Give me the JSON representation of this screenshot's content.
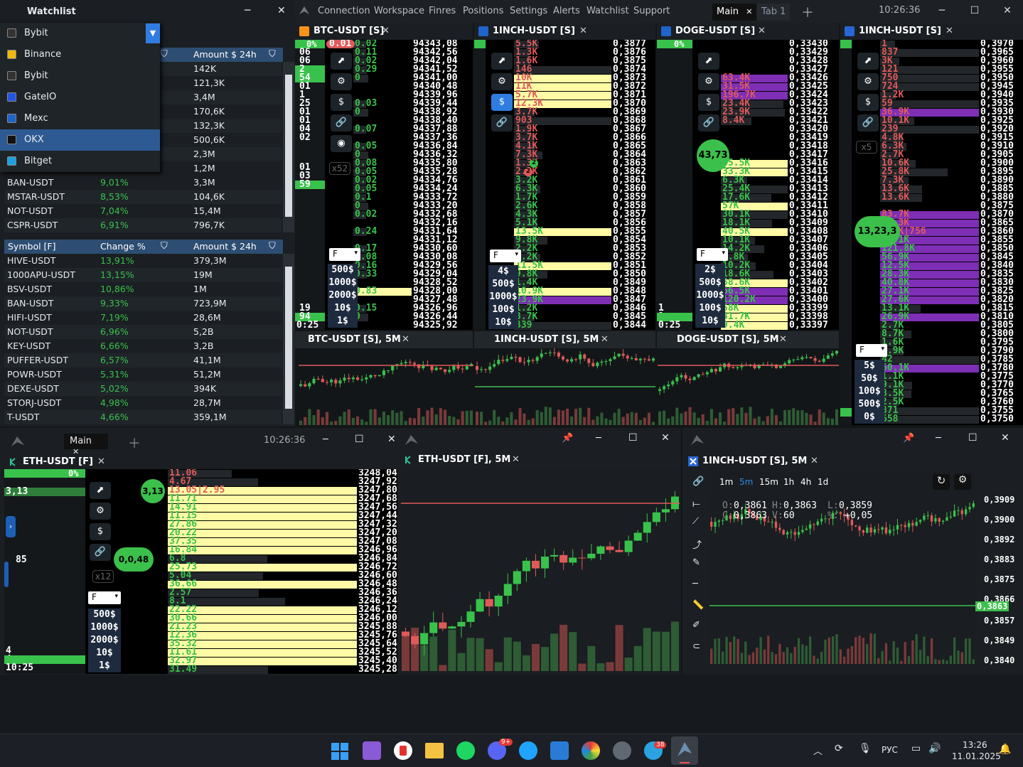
{
  "topbar": {
    "menu": [
      "Connection",
      "Workspace",
      "Finres",
      "Positions",
      "Settings",
      "Alerts",
      "Watchlist",
      "Support"
    ],
    "tab_main": "Main",
    "tab_1": "Tab 1",
    "time": "10:26:36"
  },
  "watchlist": {
    "title": "Watchlist",
    "dropdown_value": "Bybit",
    "exchanges": [
      "Bybit",
      "Binance",
      "Bybit",
      "GateIO",
      "Mexc",
      "OKX",
      "Bitget"
    ],
    "table1": {
      "header_change": "Change %",
      "header_amount": "Amount $ 24h",
      "amounts_hidden": [
        "142K",
        "121,3K",
        "3,4M",
        "170,6K",
        "132,3K",
        "500,6K",
        "2,3M",
        "1,2M"
      ],
      "rows": [
        {
          "s": "BAN-USDT",
          "c": "9,01%",
          "a": "3,3M"
        },
        {
          "s": "MSTAR-USDT",
          "c": "8,53%",
          "a": "104,6K"
        },
        {
          "s": "NOT-USDT",
          "c": "7,04%",
          "a": "15,4M"
        },
        {
          "s": "CSPR-USDT",
          "c": "6,91%",
          "a": "796,7K"
        }
      ]
    },
    "table2": {
      "header_symbol": "Symbol [F]",
      "header_change": "Change %",
      "header_amount": "Amount $ 24h",
      "rows": [
        {
          "s": "HIVE-USDT",
          "c": "13,91%",
          "a": "379,3M"
        },
        {
          "s": "1000APU-USDT",
          "c": "13,15%",
          "a": "19M"
        },
        {
          "s": "BSV-USDT",
          "c": "10,86%",
          "a": "1M"
        },
        {
          "s": "BAN-USDT",
          "c": "9,33%",
          "a": "723,9M"
        },
        {
          "s": "HIFI-USDT",
          "c": "7,19%",
          "a": "28,6M"
        },
        {
          "s": "NOT-USDT",
          "c": "6,96%",
          "a": "5,2B"
        },
        {
          "s": "KEY-USDT",
          "c": "6,66%",
          "a": "3,2B"
        },
        {
          "s": "PUFFER-USDT",
          "c": "6,57%",
          "a": "41,1M"
        },
        {
          "s": "POWR-USDT",
          "c": "5,31%",
          "a": "51,2M"
        },
        {
          "s": "DEXE-USDT",
          "c": "5,02%",
          "a": "394K"
        },
        {
          "s": "STORJ-USDT",
          "c": "4,98%",
          "a": "28,7M"
        },
        {
          "s": "T-USDT",
          "c": "4,66%",
          "a": "359,1M"
        }
      ]
    }
  },
  "panels": {
    "btc": {
      "title": "BTC-USDT [S]",
      "pct": "0%",
      "mult": "x52",
      "select": "F",
      "amounts": [
        "500$",
        "1000$",
        "2000$",
        "10$",
        "1$"
      ],
      "bottom_time": "0:25",
      "prices": [
        "94343,08",
        "94342,56",
        "94342,04",
        "94341,52",
        "94341,00",
        "94340,48",
        "94339,96",
        "94339,44",
        "94338,92",
        "94338,40",
        "94337,88",
        "94337,36",
        "94336,84",
        "94336,32",
        "94335,80",
        "94335,28",
        "94334,76",
        "94334,24",
        "94333,72",
        "94333,20",
        "94332,68",
        "94332,16",
        "94331,64",
        "94331,12",
        "94330,60",
        "94330,08",
        "94329,56",
        "94329,04",
        "94328,52",
        "94328,00",
        "94327,48",
        "94326,96",
        "94326,44",
        "94325,92"
      ],
      "vols": [
        "0.02",
        "0.11",
        "0.02",
        "0.29",
        "0",
        "",
        "",
        "0.03",
        "0",
        "",
        "0.07",
        "",
        "0.05",
        "0",
        "0.08",
        "0.05",
        "0.02",
        "0.05",
        "0.1",
        "0",
        "0.02",
        "",
        "0.24",
        "",
        "0.17",
        "0.08",
        "0.16",
        "0.33",
        "",
        "0.83",
        "",
        "0.15",
        "0",
        ""
      ],
      "left_vals": [
        "06",
        "06",
        "2",
        "54",
        "01",
        "1",
        "25",
        "01",
        "01",
        "04",
        "02"
      ],
      "left_vals2": [
        "01",
        "03",
        "59"
      ],
      "left_vals3": [
        "19",
        "94"
      ],
      "marker": "0.01"
    },
    "inch1": {
      "title": "1INCH-USDT [S]",
      "pct": "%",
      "select": "F",
      "amounts": [
        "4$",
        "500$",
        "1000$",
        "100$",
        "10$"
      ],
      "prices": [
        "0,3877",
        "0,3876",
        "0,3875",
        "0,3874",
        "0,3873",
        "0,3872",
        "0,3871",
        "0,3870",
        "0,3869",
        "0,3868",
        "0,3867",
        "0,3866",
        "0,3865",
        "0,3864",
        "0,3863",
        "0,3862",
        "0,3861",
        "0,3860",
        "0,3859",
        "0,3858",
        "0,3857",
        "0,3856",
        "0,3855",
        "0,3854",
        "0,3853",
        "0,3852",
        "0,3851",
        "0,3850",
        "0,3849",
        "0,3848",
        "0,3847",
        "0,3846",
        "0,3845",
        "0,3844"
      ],
      "vols": [
        "5.5K",
        "1.3K",
        "1.6K",
        "146",
        "10K",
        "11K",
        "5.7K",
        "12.3K",
        "3.7K",
        "903",
        "1.9K",
        "3.7K",
        "4.1K",
        "7.3K",
        "1.3K",
        "2.2K",
        "3.2K",
        "6.3K",
        "1.7K",
        "2.6K",
        "4.3K",
        "5.1K",
        "13.5K",
        "9.8K",
        "2.2K",
        "6.2K",
        "11.5K",
        "9.8K",
        "1.4K",
        "10.9K",
        "23.9K",
        "1.2K",
        "3.7K",
        "339"
      ],
      "badge1": "2",
      "badge2": "2"
    },
    "doge": {
      "title": "DOGE-USDT [S]",
      "pct": "0%",
      "select": "F",
      "amounts": [
        "2$",
        "500$",
        "1000$",
        "100$",
        "10$"
      ],
      "bubble": "43,73",
      "bottom_time": "0:25",
      "prices": [
        "0,33430",
        "0,33429",
        "0,33428",
        "0,33427",
        "0,33426",
        "0,33425",
        "0,33424",
        "0,33423",
        "0,33422",
        "0,33421",
        "0,33420",
        "0,33419",
        "0,33418",
        "0,33417",
        "0,33416",
        "0,33415",
        "0,33414",
        "0,33413",
        "0,33412",
        "0,33411",
        "0,33410",
        "0,33409",
        "0,33408",
        "0,33407",
        "0,33406",
        "0,33405",
        "0,33404",
        "0,33403",
        "0,33402",
        "0,33401",
        "0,33400",
        "0,33399",
        "0,33398",
        "0,33397"
      ],
      "vols": [
        "",
        "",
        "",
        "",
        "63.4K",
        "31.5K",
        "196.7K",
        "23.4K",
        "23.9K",
        "8.4K",
        "",
        "",
        "",
        "",
        "45.5K",
        "33.3K",
        "6.3K",
        "25.4K",
        "17.6K",
        "57K",
        "30.1K",
        "18.1K",
        "40.5K",
        "10.1K",
        "14.2K",
        "6.8K",
        "10.2K",
        "18.6K",
        "58.6K",
        "66.5K",
        "120.2K",
        "58K",
        "41.7K",
        "9.4K"
      ],
      "left_vals": [
        "1",
        "1"
      ]
    },
    "inch2": {
      "title": "1INCH-USDT [S]",
      "pct": "%",
      "mult": "x5",
      "select": "F",
      "amounts": [
        "5$",
        "50$",
        "100$",
        "500$",
        "0$"
      ],
      "bubble": "13,23,3",
      "prices": [
        "0,3970",
        "0,3965",
        "0,3960",
        "0,3955",
        "0,3950",
        "0,3945",
        "0,3940",
        "0,3935",
        "0,3930",
        "0,3925",
        "0,3920",
        "0,3915",
        "0,3910",
        "0,3905",
        "0,3900",
        "0,3895",
        "0,3890",
        "0,3885",
        "0,3880",
        "0,3875",
        "0,3870",
        "0,3865",
        "0,3860",
        "0,3855",
        "0,3850",
        "0,3845",
        "0,3840",
        "0,3835",
        "0,3830",
        "0,3825",
        "0,3820",
        "0,3815",
        "0,3810",
        "0,3805",
        "0,3800",
        "0,3795",
        "0,3790",
        "0,3785",
        "0,3780",
        "0,3775",
        "0,3770",
        "0,3765",
        "0,3760",
        "0,3755",
        "0,3750"
      ],
      "vols": [
        "1",
        "837",
        "3K",
        "121",
        "750",
        "724",
        "1.2K",
        "59",
        "36.9K",
        "10.1K",
        "239",
        "4.8K",
        "6.3K",
        "2.7K",
        "10.6K",
        "25.8K",
        "7.3K",
        "13.6K",
        "13.6K",
        "",
        "83.7K",
        "52.3K",
        "3.9K|756",
        "26.1K",
        "121.8K",
        "56.9K",
        "12.5K",
        "28.3K",
        "40.8K",
        "27.1K",
        "27.6K",
        "13.1K",
        "26.9K",
        "2.7K",
        "8.7K",
        "1.6K",
        "4.9K",
        "42",
        "60.1K",
        "1.1K",
        "9.1K",
        "8.5K",
        "2.5K",
        "871",
        "658"
      ]
    }
  },
  "mini_charts": {
    "btc": "BTC-USDT [S], 5M",
    "inch": "1INCH-USDT [S], 5M",
    "doge": "DOGE-USDT [S], 5M"
  },
  "eth_window": {
    "tab": "Main",
    "time": "10:26:36",
    "title": "ETH-USDT [F]",
    "pct": "0%",
    "left_val": "3,13",
    "left_val2": "85",
    "left_bottom": [
      "4",
      "4"
    ],
    "bottom_time": "10:25",
    "mult": "x12",
    "select": "F",
    "amounts": [
      "500$",
      "1000$",
      "2000$",
      "10$",
      "1$"
    ],
    "bubble1": "3,13",
    "bubble2": "0,0,48",
    "prices": [
      "3248,04",
      "3247,92",
      "3247,80",
      "3247,68",
      "3247,56",
      "3247,44",
      "3247,32",
      "3247,20",
      "3247,08",
      "3246,96",
      "3246,84",
      "3246,72",
      "3246,60",
      "3246,48",
      "3246,36",
      "3246,24",
      "3246,12",
      "3246,00",
      "3245,88",
      "3245,76",
      "3245,64",
      "3245,52",
      "3245,40",
      "3245,28"
    ],
    "vols": [
      "11.06",
      "4.67",
      "13.05|2.95",
      "11.71",
      "14.91",
      "11.15",
      "27.86",
      "20.22",
      "37.35",
      "16.84",
      "6.8",
      "25.73",
      "5.04",
      "36.66",
      "2.57",
      "8.1",
      "22.22",
      "30.66",
      "21.23",
      "12.36",
      "35.32",
      "11.61",
      "32.97",
      "31.49"
    ]
  },
  "eth_chart": {
    "title": "ETH-USDT [F], 5M"
  },
  "inch_chart": {
    "title": "1INCH-USDT [S], 5M",
    "timeframes": [
      "1m",
      "5m",
      "15m",
      "1h",
      "4h",
      "1d"
    ],
    "active_tf": "5m",
    "ohlc": {
      "o_label": "O:",
      "o": "0,3861",
      "h_label": "H:",
      "h": "0,3863",
      "l_label": "L:",
      "l": "0,3859",
      "c_label": "C:",
      "c": "0,3863",
      "v_label": "V:",
      "v": "60",
      "pct_label": "%:",
      "pct": "+0,05"
    },
    "y_ticks": [
      "0,3909",
      "0,3900",
      "0,3892",
      "0,3883",
      "0,3875",
      "0,3866",
      "0,3863",
      "0,3857",
      "0,3849",
      "0,3840"
    ]
  },
  "taskbar": {
    "time": "13:26",
    "date": "11.01.2025",
    "lang": "РУС",
    "discord_badge": "9+",
    "telegram_badge": "38"
  },
  "colors": {
    "buy": "#39c24b",
    "sell": "#e05a5a",
    "highlight": "#fefaa5",
    "purple": "#7e2fb5",
    "header": "#2d4e72"
  }
}
